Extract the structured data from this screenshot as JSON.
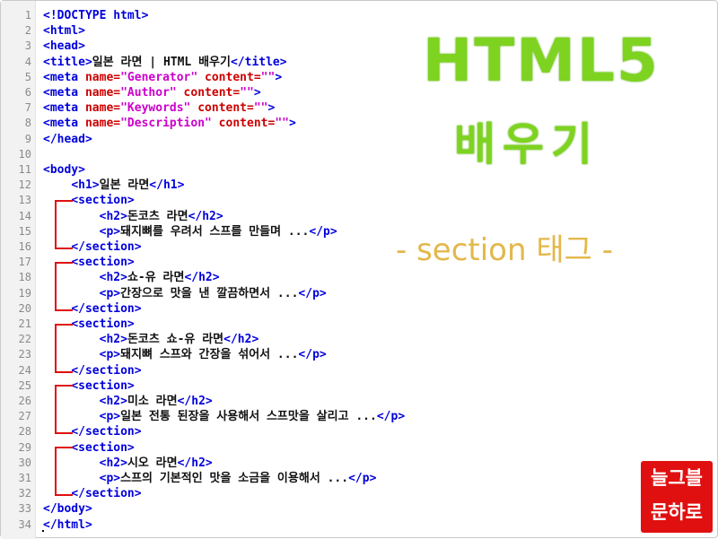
{
  "colors": {
    "tag": "#0000dd",
    "attribute": "#cc0000",
    "string": "#cc00cc",
    "title_green": "#7ed321",
    "section_gold": "#e3b84a",
    "logo_red": "#e01010"
  },
  "overlay": {
    "title_line1": "HTML5",
    "title_line2": "배우기",
    "section_tag_label": "- section 태그 -"
  },
  "logo": {
    "line1": "늘그블",
    "line2": "문하로"
  },
  "code_lines": [
    {
      "n": "1",
      "parts": [
        [
          "tag",
          "<!DOCTYPE html>"
        ]
      ]
    },
    {
      "n": "2",
      "parts": [
        [
          "tag",
          "<html>"
        ]
      ]
    },
    {
      "n": "3",
      "parts": [
        [
          "tag",
          "<head>"
        ]
      ]
    },
    {
      "n": "4",
      "parts": [
        [
          "tag",
          "<title>"
        ],
        [
          "txt",
          "일본 라면 | HTML 배우기"
        ],
        [
          "tag",
          "</title>"
        ]
      ]
    },
    {
      "n": "5",
      "parts": [
        [
          "tag",
          "<meta "
        ],
        [
          "attr",
          "name="
        ],
        [
          "str",
          "\"Generator\""
        ],
        [
          "attr",
          " content="
        ],
        [
          "str",
          "\"\""
        ],
        [
          "tag",
          ">"
        ]
      ]
    },
    {
      "n": "6",
      "parts": [
        [
          "tag",
          "<meta "
        ],
        [
          "attr",
          "name="
        ],
        [
          "str",
          "\"Author\""
        ],
        [
          "attr",
          " content="
        ],
        [
          "str",
          "\"\""
        ],
        [
          "tag",
          ">"
        ]
      ]
    },
    {
      "n": "7",
      "parts": [
        [
          "tag",
          "<meta "
        ],
        [
          "attr",
          "name="
        ],
        [
          "str",
          "\"Keywords\""
        ],
        [
          "attr",
          " content="
        ],
        [
          "str",
          "\"\""
        ],
        [
          "tag",
          ">"
        ]
      ]
    },
    {
      "n": "8",
      "parts": [
        [
          "tag",
          "<meta "
        ],
        [
          "attr",
          "name="
        ],
        [
          "str",
          "\"Description\""
        ],
        [
          "attr",
          " content="
        ],
        [
          "str",
          "\"\""
        ],
        [
          "tag",
          ">"
        ]
      ]
    },
    {
      "n": "9",
      "parts": [
        [
          "tag",
          "</head>"
        ]
      ]
    },
    {
      "n": "10",
      "parts": []
    },
    {
      "n": "11",
      "parts": [
        [
          "tag",
          "<body>"
        ]
      ]
    },
    {
      "n": "12",
      "parts": [
        [
          "txt",
          "    "
        ],
        [
          "tag",
          "<h1>"
        ],
        [
          "txt",
          "일본 라면"
        ],
        [
          "tag",
          "</h1>"
        ]
      ]
    },
    {
      "n": "13",
      "parts": [
        [
          "txt",
          "    "
        ],
        [
          "tag",
          "<section>"
        ]
      ]
    },
    {
      "n": "14",
      "parts": [
        [
          "txt",
          "        "
        ],
        [
          "tag",
          "<h2>"
        ],
        [
          "txt",
          "돈코츠 라면"
        ],
        [
          "tag",
          "</h2>"
        ]
      ]
    },
    {
      "n": "15",
      "parts": [
        [
          "txt",
          "        "
        ],
        [
          "tag",
          "<p>"
        ],
        [
          "txt",
          "돼지뼈를 우려서 스프를 만들며 ..."
        ],
        [
          "tag",
          "</p>"
        ]
      ]
    },
    {
      "n": "16",
      "parts": [
        [
          "txt",
          "    "
        ],
        [
          "tag",
          "</section>"
        ]
      ]
    },
    {
      "n": "17",
      "parts": [
        [
          "txt",
          "    "
        ],
        [
          "tag",
          "<section>"
        ]
      ]
    },
    {
      "n": "18",
      "parts": [
        [
          "txt",
          "        "
        ],
        [
          "tag",
          "<h2>"
        ],
        [
          "txt",
          "쇼-유 라면"
        ],
        [
          "tag",
          "</h2>"
        ]
      ]
    },
    {
      "n": "19",
      "parts": [
        [
          "txt",
          "        "
        ],
        [
          "tag",
          "<p>"
        ],
        [
          "txt",
          "간장으로 맛을 낸 깔끔하면서 ..."
        ],
        [
          "tag",
          "</p>"
        ]
      ]
    },
    {
      "n": "20",
      "parts": [
        [
          "txt",
          "    "
        ],
        [
          "tag",
          "</section>"
        ]
      ]
    },
    {
      "n": "21",
      "parts": [
        [
          "txt",
          "    "
        ],
        [
          "tag",
          "<section>"
        ]
      ]
    },
    {
      "n": "22",
      "parts": [
        [
          "txt",
          "        "
        ],
        [
          "tag",
          "<h2>"
        ],
        [
          "txt",
          "돈코츠 쇼-유 라면"
        ],
        [
          "tag",
          "</h2>"
        ]
      ]
    },
    {
      "n": "23",
      "parts": [
        [
          "txt",
          "        "
        ],
        [
          "tag",
          "<p>"
        ],
        [
          "txt",
          "돼지뼈 스프와 간장을 섞어서 ..."
        ],
        [
          "tag",
          "</p>"
        ]
      ]
    },
    {
      "n": "24",
      "parts": [
        [
          "txt",
          "    "
        ],
        [
          "tag",
          "</section>"
        ]
      ]
    },
    {
      "n": "25",
      "parts": [
        [
          "txt",
          "    "
        ],
        [
          "tag",
          "<section>"
        ]
      ]
    },
    {
      "n": "26",
      "parts": [
        [
          "txt",
          "        "
        ],
        [
          "tag",
          "<h2>"
        ],
        [
          "txt",
          "미소 라면"
        ],
        [
          "tag",
          "</h2>"
        ]
      ]
    },
    {
      "n": "27",
      "parts": [
        [
          "txt",
          "        "
        ],
        [
          "tag",
          "<p>"
        ],
        [
          "txt",
          "일본 전통 된장을 사용해서 스프맛을 살리고 ..."
        ],
        [
          "tag",
          "</p>"
        ]
      ]
    },
    {
      "n": "28",
      "parts": [
        [
          "txt",
          "    "
        ],
        [
          "tag",
          "</section>"
        ]
      ]
    },
    {
      "n": "29",
      "parts": [
        [
          "txt",
          "    "
        ],
        [
          "tag",
          "<section>"
        ]
      ]
    },
    {
      "n": "30",
      "parts": [
        [
          "txt",
          "        "
        ],
        [
          "tag",
          "<h2>"
        ],
        [
          "txt",
          "시오 라면"
        ],
        [
          "tag",
          "</h2>"
        ]
      ]
    },
    {
      "n": "31",
      "parts": [
        [
          "txt",
          "        "
        ],
        [
          "tag",
          "<p>"
        ],
        [
          "txt",
          "스프의 기본적인 맛을 소금을 이용해서 ..."
        ],
        [
          "tag",
          "</p>"
        ]
      ]
    },
    {
      "n": "32",
      "parts": [
        [
          "txt",
          "    "
        ],
        [
          "tag",
          "</section>"
        ]
      ]
    },
    {
      "n": "33",
      "parts": [
        [
          "tag",
          "</body>"
        ]
      ]
    },
    {
      "n": "34",
      "parts": [
        [
          "tag",
          "</html>"
        ]
      ]
    }
  ]
}
